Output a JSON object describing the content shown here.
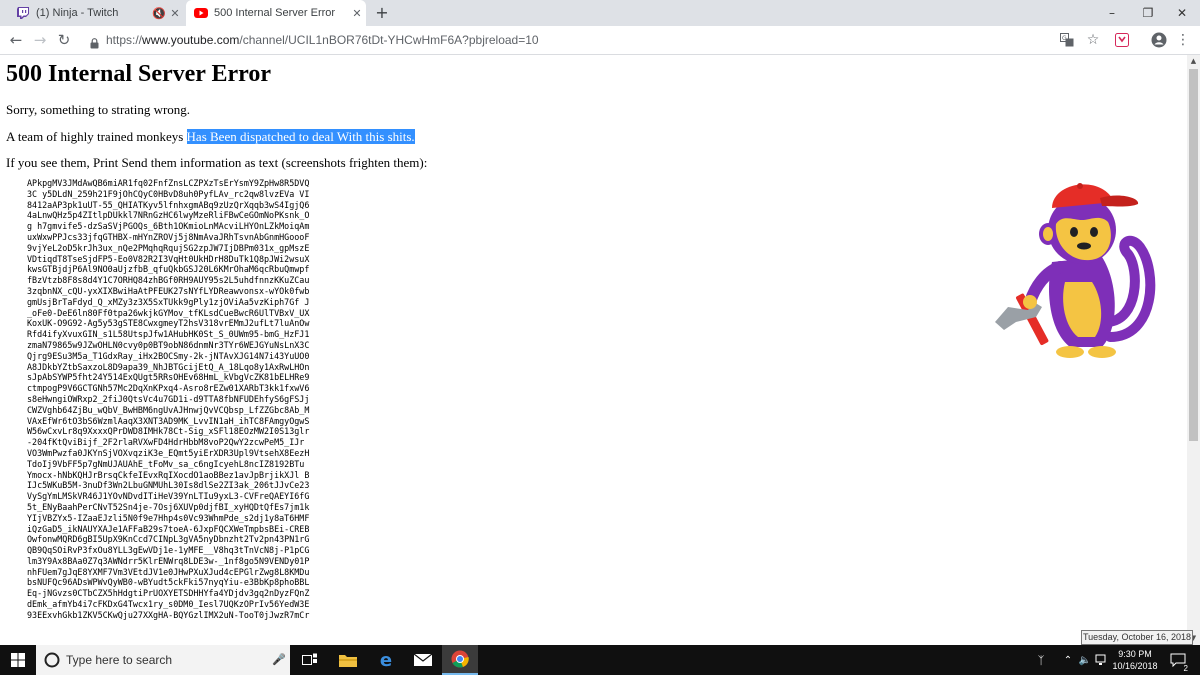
{
  "browser": {
    "tabs": [
      {
        "title": "(1) Ninja - Twitch",
        "favicon": "twitch-icon",
        "muted": true,
        "active": false
      },
      {
        "title": "500 Internal Server Error",
        "favicon": "youtube-icon",
        "active": true
      }
    ],
    "url": {
      "scheme": "https://",
      "host": "www.youtube.com",
      "path": "/channel/UCIL1nBOR76tDt-YHCwHmF6A?pbjreload=10"
    }
  },
  "page": {
    "heading": "500 Internal Server Error",
    "line1": "Sorry, something to strating wrong.",
    "line2_prefix": "A team of highly trained monkeys ",
    "line2_highlight": "Has Been dispatched to deal With this shits.",
    "line3": "If you see them, Print Send them information as text (screenshots frighten them):",
    "debug_lines": [
      "APkpgMV3JMdAwQB6miAR1fq02FnfZnsLCZPXzTsErYsmY9ZpHw8R5DVQ",
      "3C y5DLdN_259h21F9jOhCQyC0HBvD8uh0PyfLAv_rc2qw8lvzEVa VI",
      "8412aAP3pk1uUT-55_QHIATKyv5lfnhxgmABq9zUzQrXqqb3wS4IgjQ6",
      "4aLnwQHz5p4ZItlpDUkkl7NRnGzHC6lwyMzeRliFBwCeGOmNoPKsnk_O",
      "g h7gmvife5-dzSaSVjPGOQs_6Bth1OKmioLnMAcviLHYOnLZkMoiqAm",
      "uxWxwPPJcs33jfqGTHBX-mHYnZROVj5j8NmAvaJRhTsvnAbGnmHGoooF",
      "9vjYeL2oD5krJh3ux_nQe2PMqhqRqujSG2zpJW7IjDBPm031x_gpMszE",
      "VDtiqdT8TseSjdFP5-Eo0V82R2I3VqHt0UkHDrH8DuTk1Q8pJWi2wsuX",
      "kwsGTBjdjP6Al9NO0aUjzfbB_qfuQkbGSJ20L6KMrOhaM6qcRbuQmwpf",
      "fBzVtzb8F8s8d4Y1C7ORHQ84zhBGf0RH9AUY95s2L5uhdfnnzKKuZCau",
      "3zqbnNX_cQU-yxXIXBwiHaAtPFEUK27sNYfLYDReawvonsx-wYOk0fwb",
      "gmUsjBrTaFdyd_Q_xMZy3z3X5SxTUkk9gPly1zjOViAa5vzKiph7Gf J",
      "_oFe0-DeE6ln80Ff0tpa26wkjkGYMov_tfKLsdCueBwcR6UlTVBxV_UX",
      "KoxUK-O9G92-Ag5y53gSTE8CwxgmeyT2hsV318vrEMmJ2ufLt7luAnOw",
      "Rfd4ifyXvuxGIN_s1L58UtspJfw1AHubHK0St_S_0UWm95-bmG_HzFJ1",
      "zmaN79865w9JZwOHLN0cvy0p0BT9obN86dnmNr3TYr6WEJGYuNsLnX3C",
      "Qjrg9ESu3M5a_T1GdxRay_iHx2BOCSmy-2k-jNTAvXJG14N7i43YuUO0",
      "A8JDkbYZtbSaxzoL8D9apa39_NhJBTGcijEtQ_A_18Lqo8y1AxRwLHOn",
      "sJpAbSYWP5fht24Y514ExQUgt5RRsOHEv68HmL_kVbgVcZK81bELHRe9",
      "ctmpogP9V6GCTGNh57Mc2DqXnKPxq4-Asro8rEZw01XARbT3kk1fxwV6",
      "s8eHwngiOWRxp2_2fiJ0QtsVc4u7GD1i-d9TTA8fbNFUDEhfyS6gFSJj",
      "CWZVghb64ZjBu_wQbV_BwHBM6ngUvAJHnwjQvVCQbsp_LfZZGbc8Ab_M",
      "VAxEfWr6tO3bS6WzmlAaqX3XNT3AD9MK_LvvIN1aH_ihTC8FAmgyOgwS",
      "W56wCxvLr8q9XxxxQPrDWD8IMHk78Ct-Sig_xSFl18EOzMW2I0S13glr",
      "-204fKtQviBijf_2F2rlaRVXwFD4HdrHbbM8voP2QwY2zcwPeM5_IJr",
      "VO3WmPwzfa0JKYnSjVOXvqziK3e_EQmt5yiErXDR3Upl9VtsehX8EezH",
      "TdoIj9VbFF5p7gNmUJAUAhE_tFoMv_sa_c6ngIcyehL8ncIZ8192BTu",
      "Ymocx-hNbKQHJrBrsqCkfeIEvxRqIXocdO1aoBBez1avJpBrjikXJl B",
      "IJc5WKuB5M-3nuDf3Wn2LbuGNMUhL30Is8dlSe2ZI3ak_206tJJvCe23",
      "VySgYmLMSkVR46J1YOvNDvdITiHeV39YnLTIu9yxL3-CVFreQAEYI6fG",
      "5t_ENyBaahPerCNvT52Sn4je-7Osj6XUVp0djfBI_xyHQDtQfEs7jm1k",
      "YIjVBZYx5-IZaaEJzli5N0f9e7Hhp4s0Vc93WhmPde_s2dj1y8aT6HMF",
      "iQzGaD5_ikNAUYXAJe1AFFaB29s7toeA-6JxpFQCXWeTmpbsBEi-CREB",
      "OwfonwMQRD6gBI5UpX9KnCcd7CINpL3gVA5nyDbnzht2Tv2pn43PN1rG",
      "QB9QqSOiRvP3fxOu8YLL3gEwVDj1e-1yMFE__V8hq3tTnVcN8j-P1pCG",
      "lm3Y9Ax8BAa0Z7q3AWNdrr5KlrENWrq8LDE3w-_1nf8go5N9VENDy01P",
      "nhFUem7gJqE8YXMF7Vm3VEtdJV1e0JHwPXuXJud4cEPGlrZwg8L8KMDu",
      "bsNUFQc96ADsWPWvQyWB0-wBYudt5ckFki57nyqYiu-e3BbKp8phoBBL",
      "Eq-jNGvzs0CTbCZX5hHdgtiPrUOXYETSDHHYfa4YDjdv3gq2nDyzFQnZ",
      "dEmk_afmYb4i7cFKDxG4Twcx1ry_s0DM0_Iesl7UQKzOPrIv56YedW3E",
      "93EExvhGkb1ZKV5CKwQju27XXgHA-BQYGzlIMX2uN-TooT0jJwzR7mCr"
    ]
  },
  "taskbar": {
    "search_placeholder": "Type here to search",
    "time": "9:30 PM",
    "date": "10/16/2018",
    "date_tooltip": "Tuesday, October 16, 2018",
    "notification_count": "2"
  },
  "colors": {
    "selection": "#3390ff",
    "tabstrip": "#dee1e6",
    "taskbar": "#101010",
    "youtube_red": "#ff0000",
    "twitch_purple": "#6441a5",
    "monkey_purple": "#7e2fb8",
    "monkey_face": "#f4c443",
    "monkey_hat": "#e52d27"
  }
}
